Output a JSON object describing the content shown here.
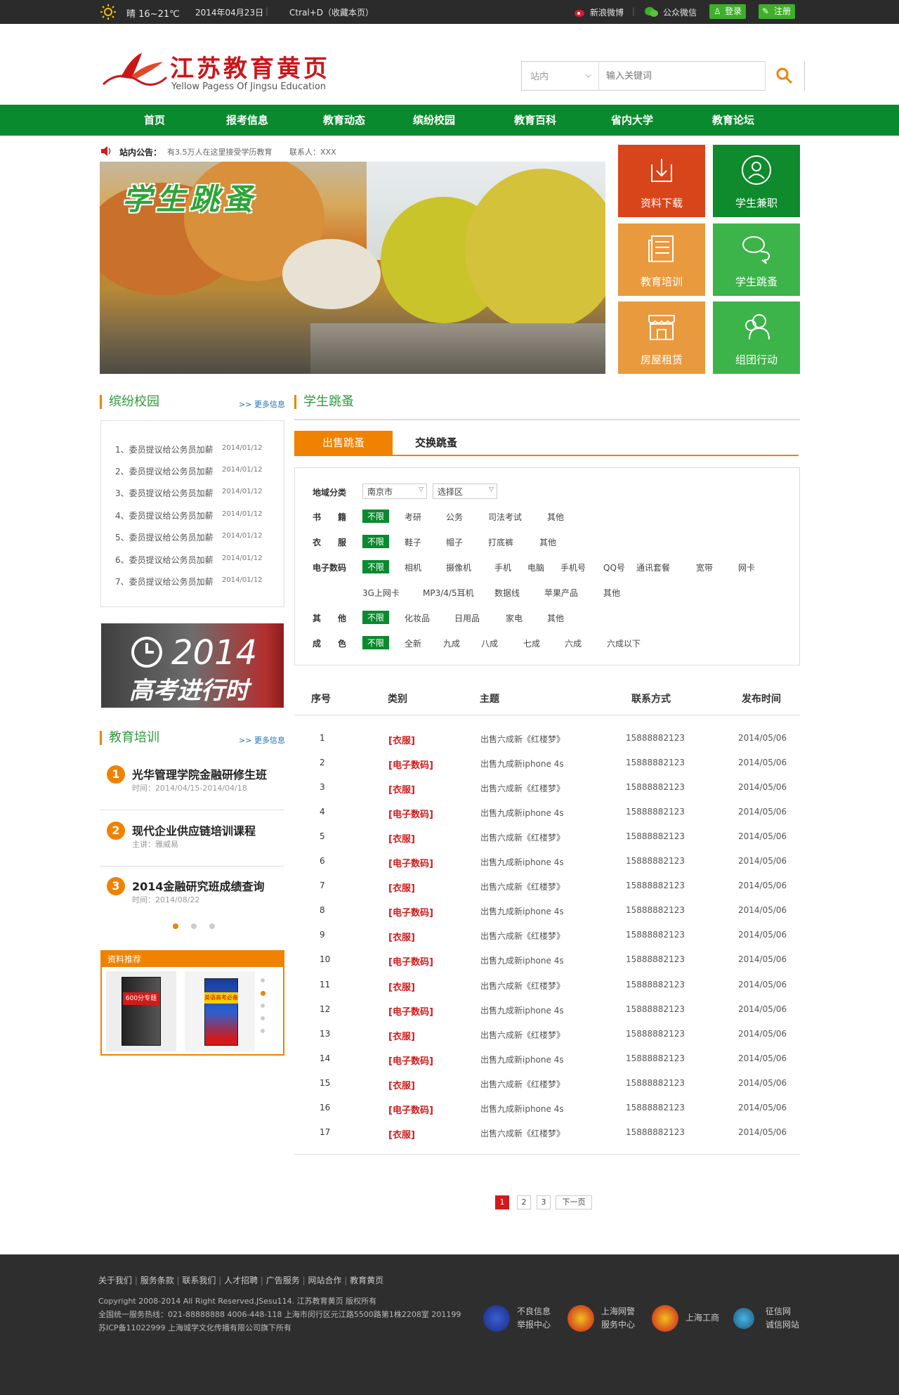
{
  "topbar": {
    "weather": "晴 16~21℃",
    "date": "2014年04月23日",
    "bookmark": "Ctral+D（收藏本页）",
    "weibo": "新浪微博",
    "wechat": "公众微信",
    "login": "登录",
    "register": "注册"
  },
  "logo": {
    "cn": "江苏教育黄页",
    "en": "Yellow Pagess Of Jingsu Education"
  },
  "search": {
    "scope": "站内",
    "placeholder": "输入关键词"
  },
  "nav": [
    "首页",
    "报考信息",
    "教育动态",
    "缤纷校园",
    "教育百科",
    "省内大学",
    "教育论坛"
  ],
  "notice": {
    "label": "站内公告：",
    "text": "有3.5万人在这里接受学历教育",
    "contact": "联系人：XXX"
  },
  "banner": {
    "title": "学生跳蚤"
  },
  "tiles": [
    {
      "label": "资料下载",
      "icon": "download-icon",
      "color": "#d9451a"
    },
    {
      "label": "学生兼职",
      "icon": "user-icon",
      "color": "#0f8a2c"
    },
    {
      "label": "教育培训",
      "icon": "newspaper-icon",
      "color": "#e99a3e"
    },
    {
      "label": "学生跳蚤",
      "icon": "chat-icon",
      "color": "#3db449"
    },
    {
      "label": "房屋租赁",
      "icon": "shop-icon",
      "color": "#e99a3e"
    },
    {
      "label": "组团行动",
      "icon": "group-icon",
      "color": "#3db449"
    }
  ],
  "campus": {
    "title": "缤纷校园",
    "more": "更多信息",
    "items": [
      {
        "n": "1",
        "text": "委员提议给公务员加薪",
        "date": "2014/01/12"
      },
      {
        "n": "2",
        "text": "委员提议给公务员加薪",
        "date": "2014/01/12"
      },
      {
        "n": "3",
        "text": "委员提议给公务员加薪",
        "date": "2014/01/12"
      },
      {
        "n": "4",
        "text": "委员提议给公务员加薪",
        "date": "2014/01/12"
      },
      {
        "n": "5",
        "text": "委员提议给公务员加薪",
        "date": "2014/01/12"
      },
      {
        "n": "6",
        "text": "委员提议给公务员加薪",
        "date": "2014/01/12"
      },
      {
        "n": "7",
        "text": "委员提议给公务员加薪",
        "date": "2014/01/12"
      }
    ]
  },
  "ad": {
    "year": "2014",
    "text": "高考进行时"
  },
  "training": {
    "title": "教育培训",
    "more": "更多信息",
    "items": [
      {
        "n": "1",
        "title": "光华管理学院金融研修生班",
        "sub": "时间：2014/04/15-2014/04/18"
      },
      {
        "n": "2",
        "title": "现代企业供应链培训课程",
        "sub": "主讲：雅威易"
      },
      {
        "n": "3",
        "title": "2014金融研究班成绩查询",
        "sub": "时间：2014/08/22"
      }
    ]
  },
  "recommend": {
    "title": "资料推荐",
    "book1": "600分专题",
    "book2": "英语高考必备"
  },
  "flea": {
    "title": "学生跳蚤",
    "tabs": [
      "出售跳蚤",
      "交换跳蚤"
    ],
    "region_label": "地域分类",
    "city": "南京市",
    "district": "选择区",
    "filters": [
      {
        "label": "书　　籍",
        "active": "不限",
        "opts": [
          "考研",
          "公务",
          "司法考试",
          "其他"
        ]
      },
      {
        "label": "衣　　服",
        "active": "不限",
        "opts": [
          "鞋子",
          "帽子",
          "打底裤",
          "其他"
        ]
      },
      {
        "label": "电子数码",
        "active": "不限",
        "opts": [
          "相机",
          "摄像机",
          "手机",
          "电脑",
          "手机号",
          "QQ号",
          "通讯套餐",
          "宽带",
          "网卡"
        ],
        "opts2": [
          "3G上网卡",
          "MP3/4/5耳机",
          "数据线",
          "苹果产品",
          "其他"
        ]
      },
      {
        "label": "其　　他",
        "active": "不限",
        "opts": [
          "化妆品",
          "日用品",
          "家电",
          "其他"
        ]
      },
      {
        "label": "成　　色",
        "active": "不限",
        "opts": [
          "全新",
          "九成",
          "八成",
          "七成",
          "六成",
          "六成以下"
        ]
      }
    ],
    "headers": [
      "序号",
      "类别",
      "主题",
      "联系方式",
      "发布时间"
    ],
    "rows": [
      {
        "n": "1",
        "cat": "[衣服]",
        "title": "出售六成新《红楼梦》",
        "phone": "15888882123",
        "date": "2014/05/06"
      },
      {
        "n": "2",
        "cat": "[电子数码]",
        "title": "出售九成新iphone 4s",
        "phone": "15888882123",
        "date": "2014/05/06"
      },
      {
        "n": "3",
        "cat": "[衣服]",
        "title": "出售六成新《红楼梦》",
        "phone": "15888882123",
        "date": "2014/05/06"
      },
      {
        "n": "4",
        "cat": "[电子数码]",
        "title": "出售九成新iphone 4s",
        "phone": "15888882123",
        "date": "2014/05/06"
      },
      {
        "n": "5",
        "cat": "[衣服]",
        "title": "出售六成新《红楼梦》",
        "phone": "15888882123",
        "date": "2014/05/06"
      },
      {
        "n": "6",
        "cat": "[电子数码]",
        "title": "出售九成新iphone 4s",
        "phone": "15888882123",
        "date": "2014/05/06"
      },
      {
        "n": "7",
        "cat": "[衣服]",
        "title": "出售六成新《红楼梦》",
        "phone": "15888882123",
        "date": "2014/05/06"
      },
      {
        "n": "8",
        "cat": "[电子数码]",
        "title": "出售九成新iphone 4s",
        "phone": "15888882123",
        "date": "2014/05/06"
      },
      {
        "n": "9",
        "cat": "[衣服]",
        "title": "出售六成新《红楼梦》",
        "phone": "15888882123",
        "date": "2014/05/06"
      },
      {
        "n": "10",
        "cat": "[电子数码]",
        "title": "出售九成新iphone 4s",
        "phone": "15888882123",
        "date": "2014/05/06"
      },
      {
        "n": "11",
        "cat": "[衣服]",
        "title": "出售六成新《红楼梦》",
        "phone": "15888882123",
        "date": "2014/05/06"
      },
      {
        "n": "12",
        "cat": "[电子数码]",
        "title": "出售九成新iphone 4s",
        "phone": "15888882123",
        "date": "2014/05/06"
      },
      {
        "n": "13",
        "cat": "[衣服]",
        "title": "出售六成新《红楼梦》",
        "phone": "15888882123",
        "date": "2014/05/06"
      },
      {
        "n": "14",
        "cat": "[电子数码]",
        "title": "出售九成新iphone 4s",
        "phone": "15888882123",
        "date": "2014/05/06"
      },
      {
        "n": "15",
        "cat": "[衣服]",
        "title": "出售六成新《红楼梦》",
        "phone": "15888882123",
        "date": "2014/05/06"
      },
      {
        "n": "16",
        "cat": "[电子数码]",
        "title": "出售九成新iphone 4s",
        "phone": "15888882123",
        "date": "2014/05/06"
      },
      {
        "n": "17",
        "cat": "[衣服]",
        "title": "出售六成新《红楼梦》",
        "phone": "15888882123",
        "date": "2014/05/06"
      }
    ],
    "pager": [
      "1",
      "2",
      "3",
      "下一页"
    ]
  },
  "footer": {
    "links": [
      "关于我们",
      "服务条款",
      "联系我们",
      "人才招聘",
      "广告服务",
      "网站合作",
      "教育黄页"
    ],
    "copyright": "Copyright 2008-2014 All Right Reserved.JSesu114. 江苏教育黄页 版权所有",
    "hotline": "全国统一服务热线：021-88888888 4006-448-118  上海市闵行区元江路5500路第1株2208室 201199",
    "icp": "苏ICP备11022999   上海城学文化传播有限公司旗下所有",
    "badges": [
      {
        "l1": "不良信息",
        "l2": "举报中心"
      },
      {
        "l1": "上海网警",
        "l2": "服务中心"
      },
      {
        "l1": "上海工商",
        "l2": ""
      },
      {
        "l1": "征信网",
        "l2": "诚信网站"
      }
    ]
  }
}
